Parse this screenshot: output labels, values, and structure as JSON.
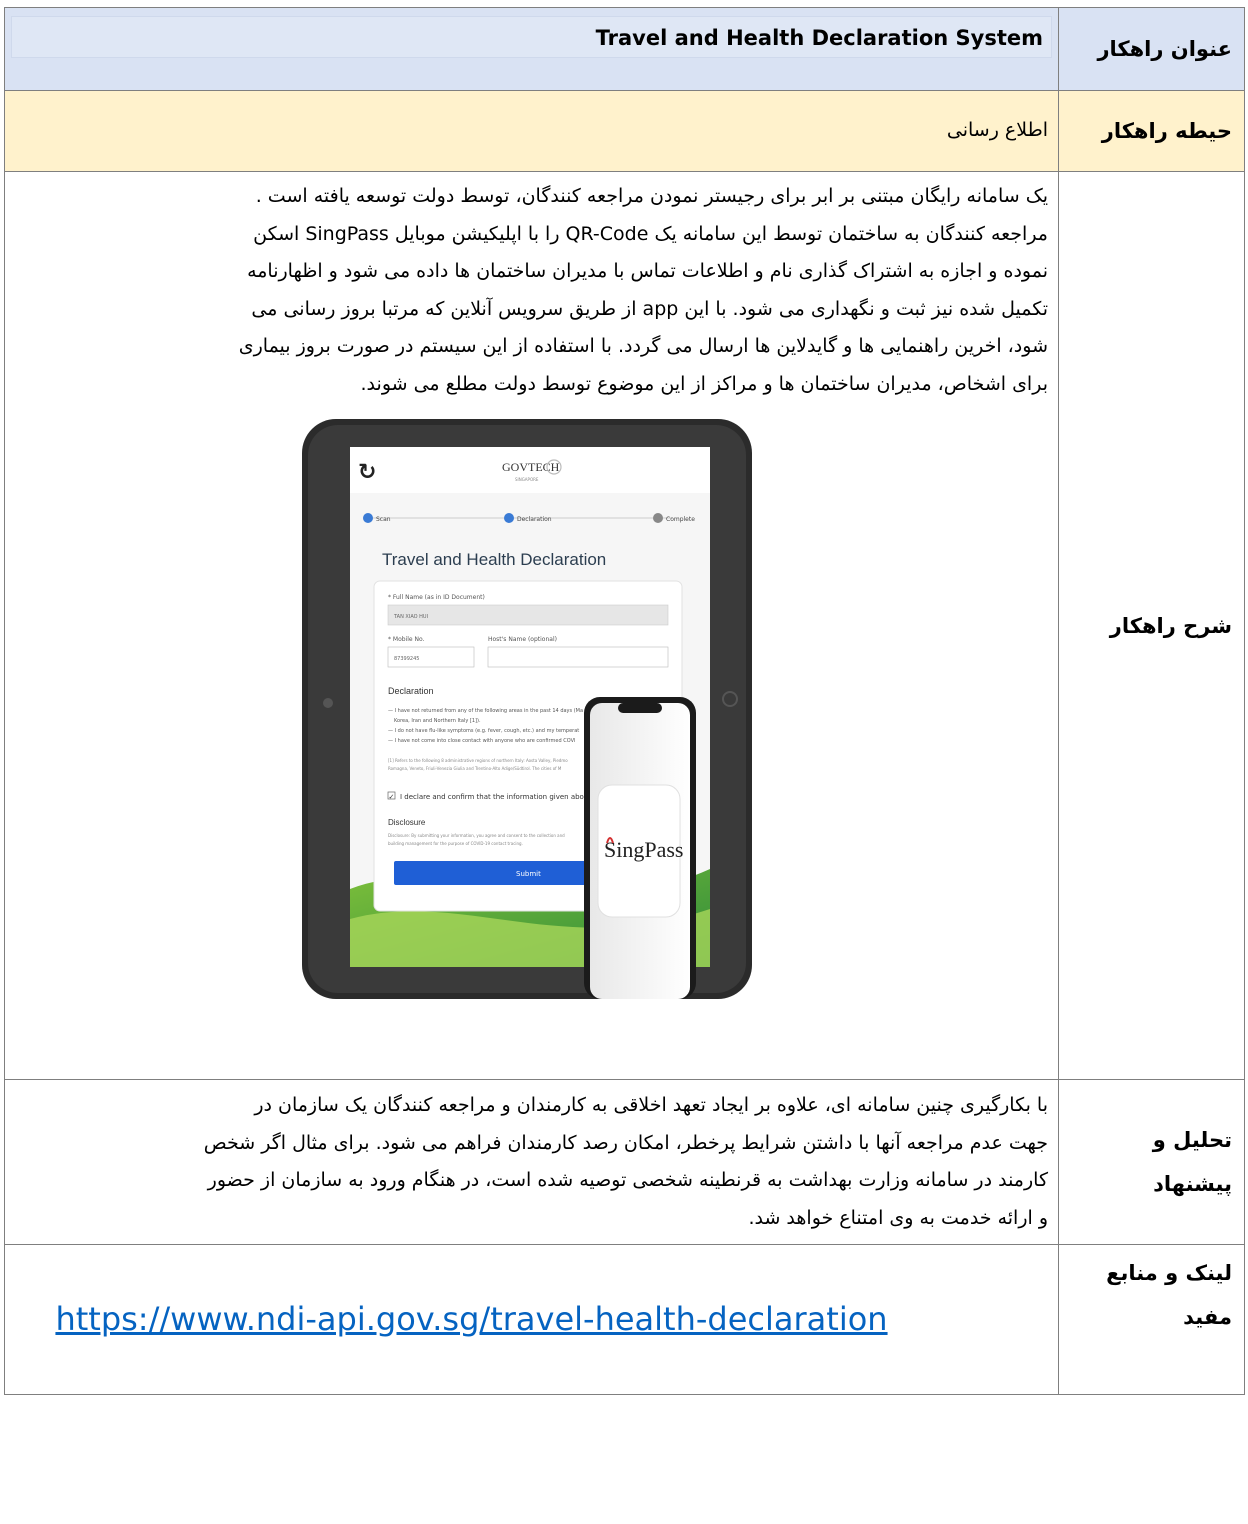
{
  "rows": {
    "title": {
      "label": "عنوان راهکار",
      "value": "Travel and Health Declaration System"
    },
    "domain": {
      "label": "حیطه راهکار",
      "value": "اطلاع رسانی"
    },
    "description": {
      "label": "شرح راهکار",
      "lines": [
        "یک سامانه رایگان مبتنی بر ابر برای رجیستر نمودن مراجعه کنندگان،  توسط دولت توسعه یافته است .",
        "مراجعه کنندگان به ساختمان توسط این سامانه یک QR-Code را با اپلیکیشن موبایل SingPass اسکن",
        "نموده و اجازه به اشتراک گذاری نام و اطلاعات تماس با مدیران ساختمان ها داده می شود و اظهارنامه",
        "تکمیل شده نیز ثبت و نگهداری می شود. با این app از طریق سرویس آنلاین که مرتبا بروز رسانی می",
        "شود، اخرین راهنمایی ها و گایدلاین ها ارسال می گردد. با استفاده از این سیستم در صورت بروز بیماری",
        "برای اشخاص، مدیران ساختمان ها و مراکز از این موضوع توسط دولت مطلع می شوند."
      ],
      "figure": {
        "logo": "GOVTECH",
        "logo_sub": "SINGAPORE",
        "steps": [
          "Scan",
          "Declaration",
          "Complete"
        ],
        "form_title": "Travel and Health Declaration",
        "full_name_label": "* Full Name (as in ID Document)",
        "full_name_value": "TAN XIAO HUI",
        "mobile_label": "* Mobile No.",
        "mobile_value": "87399245",
        "host_label": "Host's Name (optional)",
        "declaration_heading": "Declaration",
        "declaration_items": [
          "— I have not returned from any of the following areas in the past 14 days (Ma",
          "Korea, Iran and Northern Italy [1]).",
          "— I do not have flu-like symptoms (e.g. fever, cough, etc.) and my temperat",
          "— I have not come into close contact with anyone who are confirmed COVI"
        ],
        "footnote_lines": [
          "[1] Refers to the following 8 administrative regions of northern Italy: Aosta Valley, Piedmo",
          "Romagna, Veneto, Friuli-Venezia Giulia and Trentino-Alto Adige/Südtirol. The cities of M"
        ],
        "confirm_text": "I declare and confirm that the information given above is true c",
        "disclosure_heading": "Disclosure",
        "disclosure_lines": [
          "Disclosure: By submitting your information, you agree and consent to the collection and",
          "building management for the purpose of COVID-19 contact tracing."
        ],
        "submit_label": "Submit",
        "phone_app": "SingPass"
      }
    },
    "analysis": {
      "label_lines": [
        "تحلیل و",
        "پیشنهاد"
      ],
      "lines": [
        "با بکارگیری چنین سامانه ای، علاوه بر ایجاد تعهد اخلاقی به کارمندان و مراجعه کنندگان یک سازمان در",
        "جهت عدم مراجعه آنها با داشتن شرایط پرخطر، امکان رصد کارمندان فراهم می شود. برای مثال اگر شخص",
        "کارمند در سامانه وزارت بهداشت به قرنطینه شخصی توصیه شده است، در هنگام ورود به سازمان از حضور",
        "و ارائه خدمت به وی امتناع خواهد شد."
      ]
    },
    "links": {
      "label_lines": [
        "لینک و منابع",
        "مفید"
      ],
      "url": "https://www.ndi-api.gov.sg/travel-health-declaration"
    }
  },
  "colors": {
    "title_row_bg": "#d9e2f3",
    "domain_row_bg": "#fff2cc",
    "link": "#0563c1",
    "submit_button": "#1f5fd6"
  }
}
